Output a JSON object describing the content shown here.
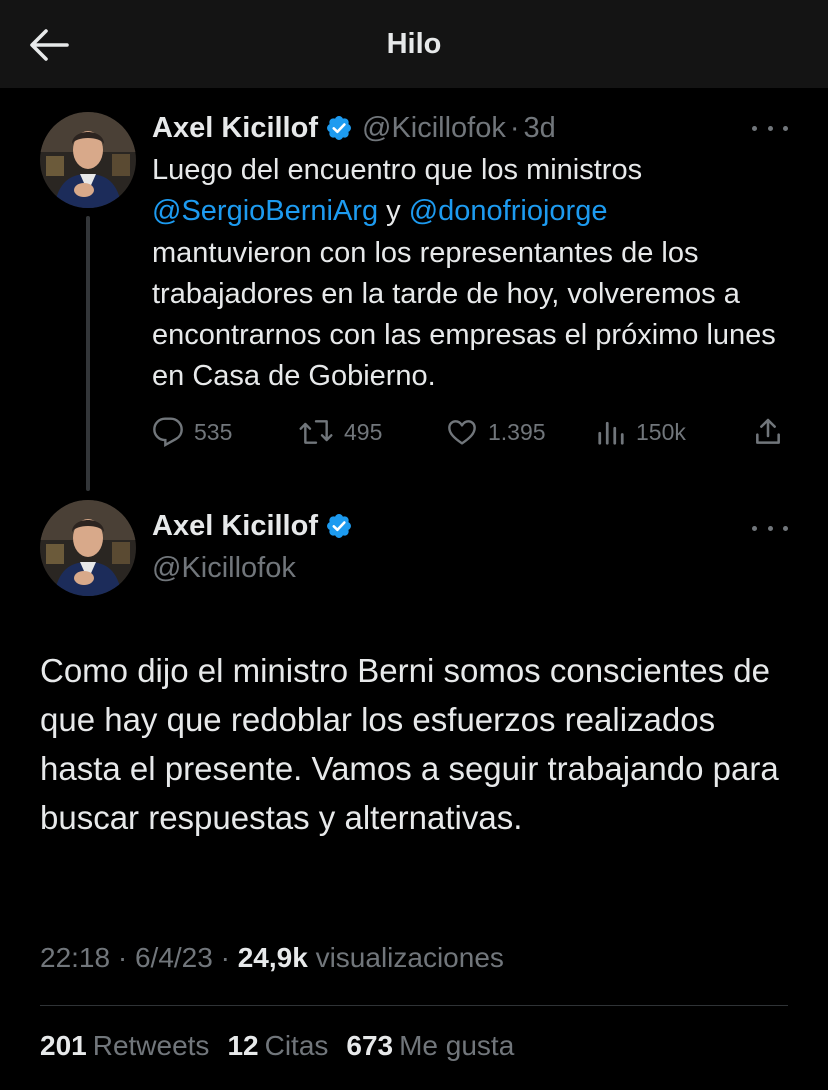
{
  "header": {
    "title": "Hilo",
    "back_icon": "arrow-left-icon"
  },
  "colors": {
    "background": "#000000",
    "accent": "#1d9bf0",
    "muted": "#71767b",
    "text": "#e7e9ea"
  },
  "parent_tweet": {
    "name": "Axel Kicillof",
    "handle": "@Kicillofok",
    "separator": "·",
    "time": "3d",
    "text_1": "Luego del encuentro que los ministros",
    "mention_1": "@SergioBerniArg",
    "connector": " y ",
    "mention_2": "@donofriojorge",
    "text_2": "mantuvieron con los representantes de los trabajadores en la tarde de hoy, volveremos a encontrarnos con las empresas el próximo lunes en Casa de Gobierno.",
    "replies": "535",
    "retweets": "495",
    "likes": "1.395",
    "views": "150k"
  },
  "main_tweet": {
    "name": "Axel Kicillof",
    "handle": "@Kicillofok",
    "text": "Como dijo el ministro Berni somos conscientes de que hay que redoblar los esfuerzos realizados hasta el presente. Vamos a seguir trabajando para buscar respuestas y alternativas.",
    "time": "22:18",
    "sep1": "·",
    "date": "6/4/23",
    "sep2": "·",
    "views_count": "24,9k",
    "views_label": "visualizaciones",
    "retweets_count": "201",
    "retweets_label": "Retweets",
    "quotes_count": "12",
    "quotes_label": "Citas",
    "likes_count": "673",
    "likes_label": "Me gusta"
  }
}
